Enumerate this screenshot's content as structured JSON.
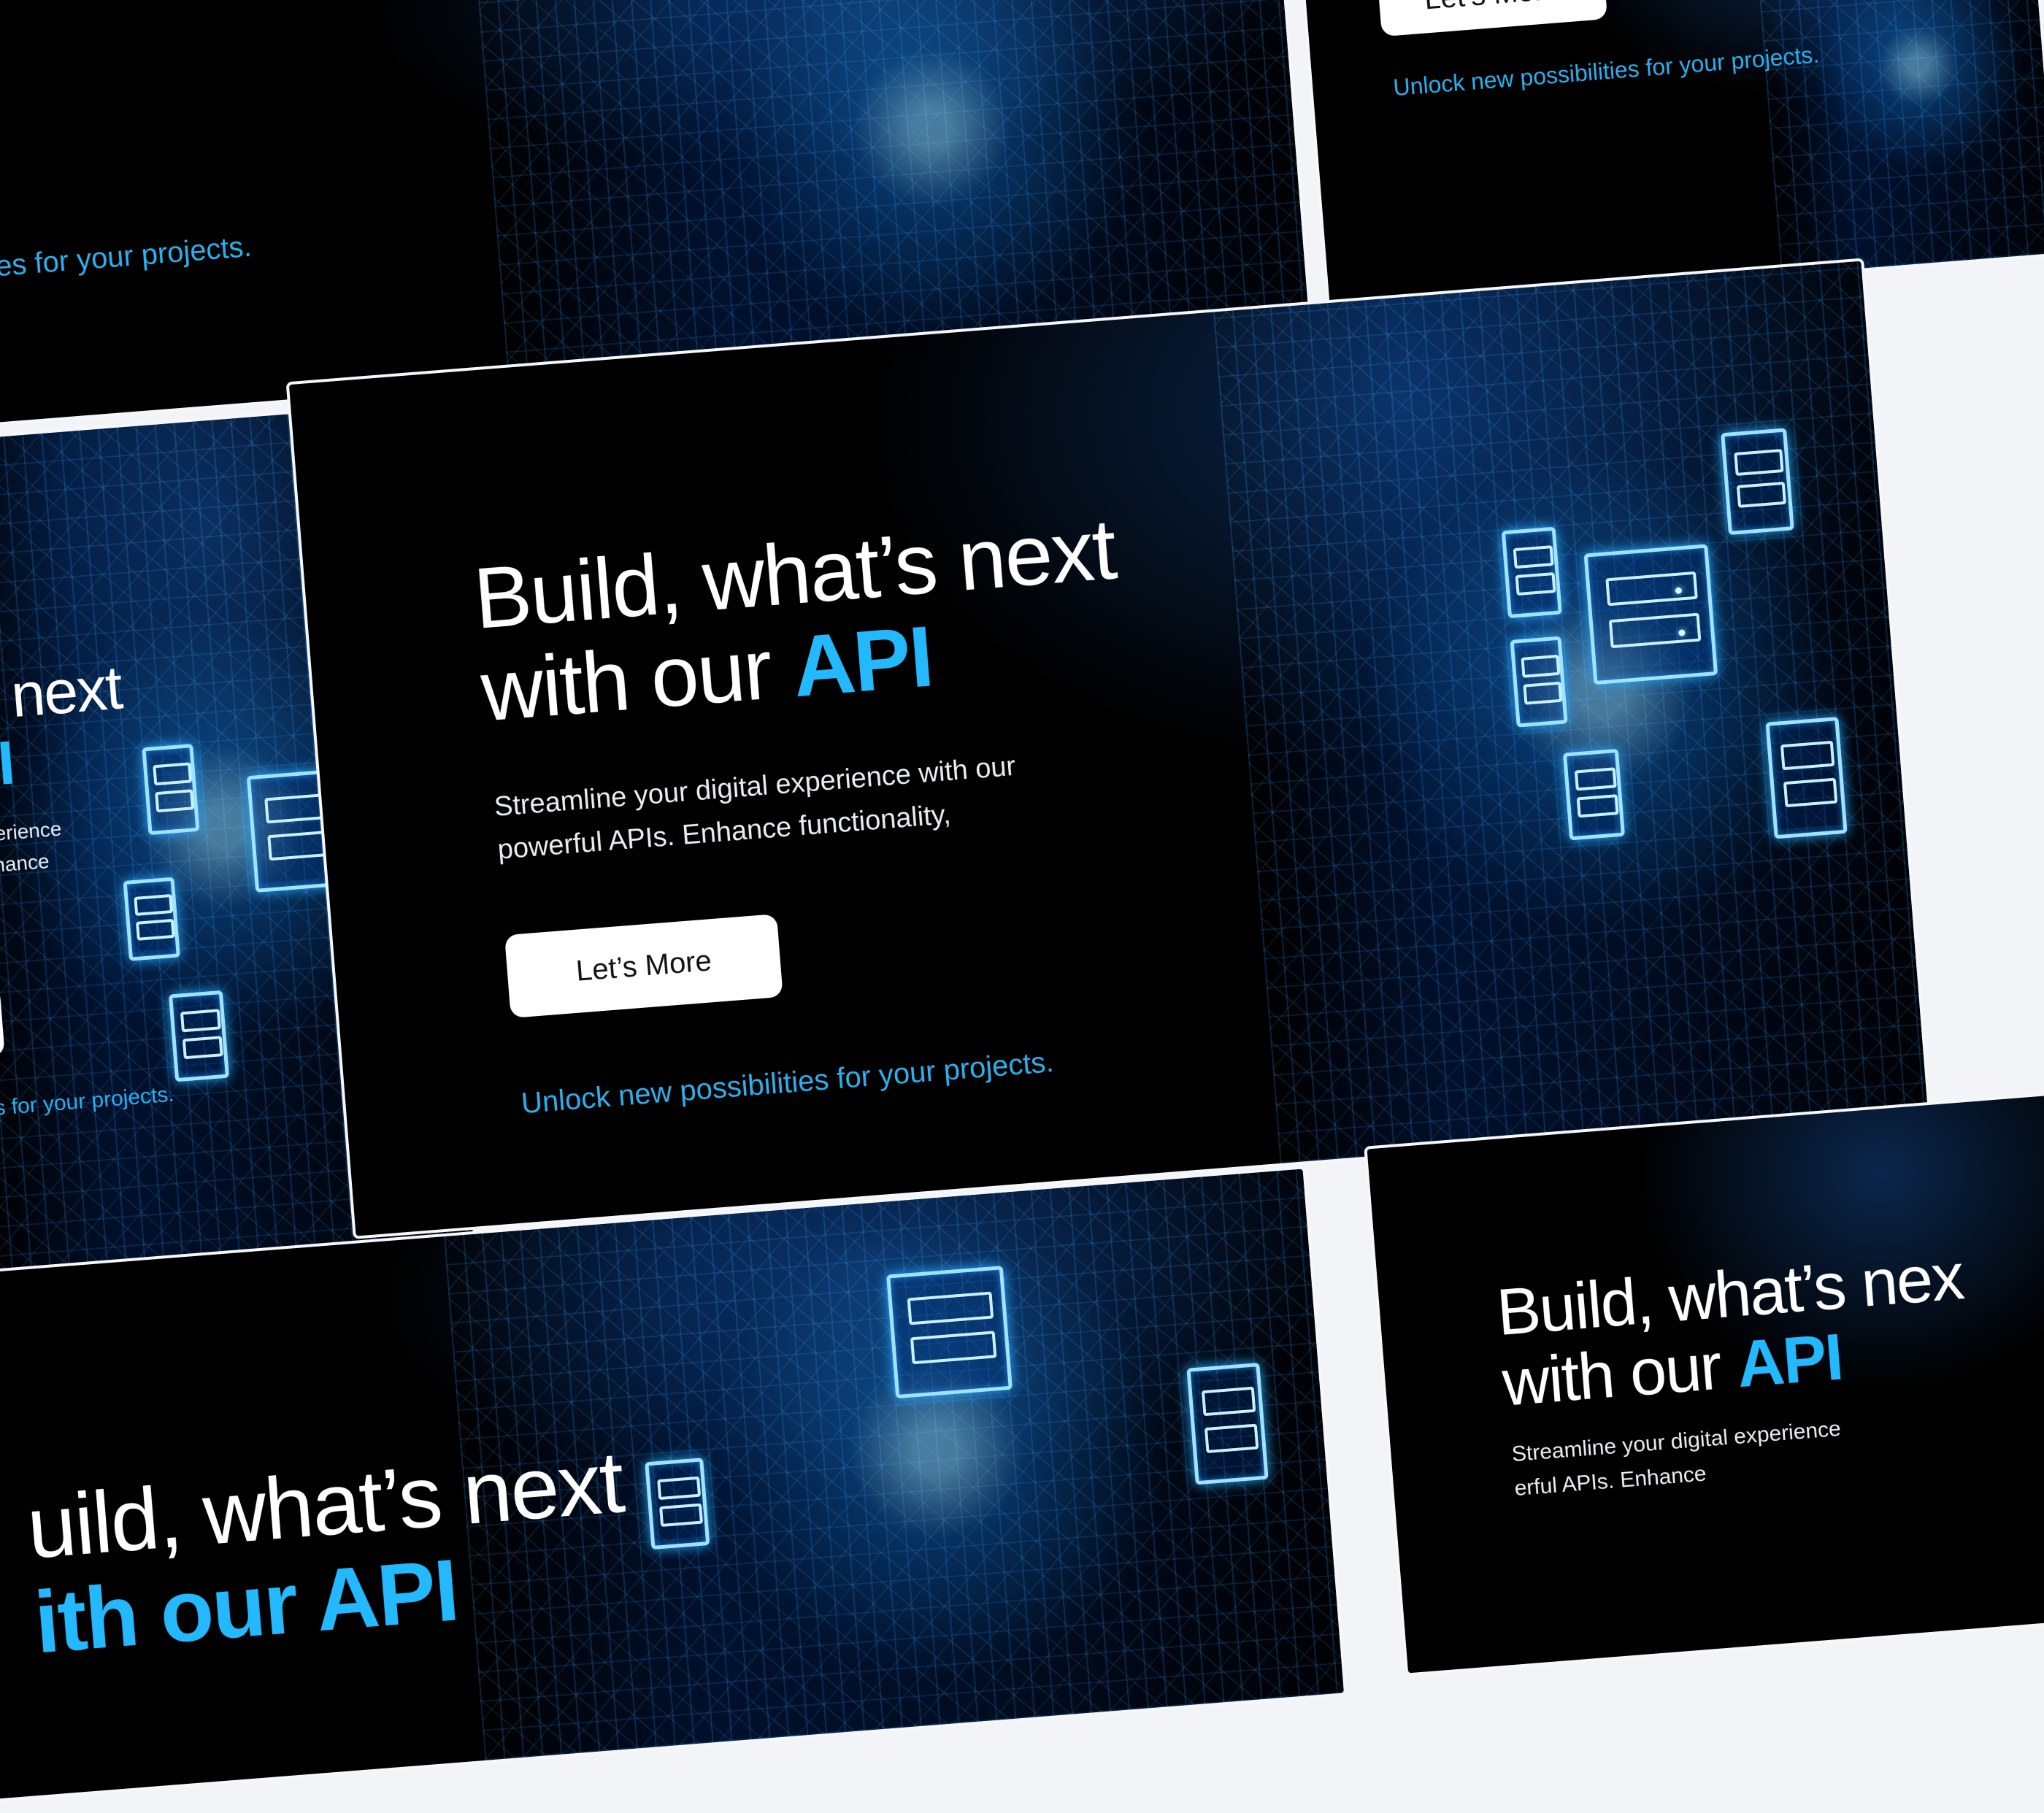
{
  "banner": {
    "headline_line1": "Build, what’s next",
    "headline_line2_prefix": "with our ",
    "headline_highlight": "API",
    "subtitle_line1": "Streamline your digital experience with our",
    "subtitle_line2": "powerful APIs. Enhance functionality,",
    "cta_label": "Let’s More",
    "unlock_text": "Unlock new possibilities for your projects."
  },
  "snippets": {
    "headline_partial_left": "hat’s next",
    "headline_highlight_left": "r API",
    "subtitle_partial_left1": "al experience",
    "subtitle_partial_left2": "ls. Enhance",
    "unlock_partial_left": "sibilities for your projects.",
    "topleft_cta_partial": "ore",
    "topleft_unlock_partial": "possibilities for your projects.",
    "bottom_headline_partial": "uild, what’s next",
    "bottom_highlight_partial": "ith our API",
    "br_headline1": "Build, what’s nex",
    "br_headline2_prefix": "with our ",
    "br_highlight": "API",
    "br_subtitle1": "Streamline your digital experience",
    "br_subtitle2": "erful APIs. Enhance"
  },
  "colors": {
    "accent": "#24b9ff",
    "link": "#2cb0ee",
    "background": "#000000",
    "button": "#ffffff"
  },
  "icons": [
    "server-icon"
  ]
}
